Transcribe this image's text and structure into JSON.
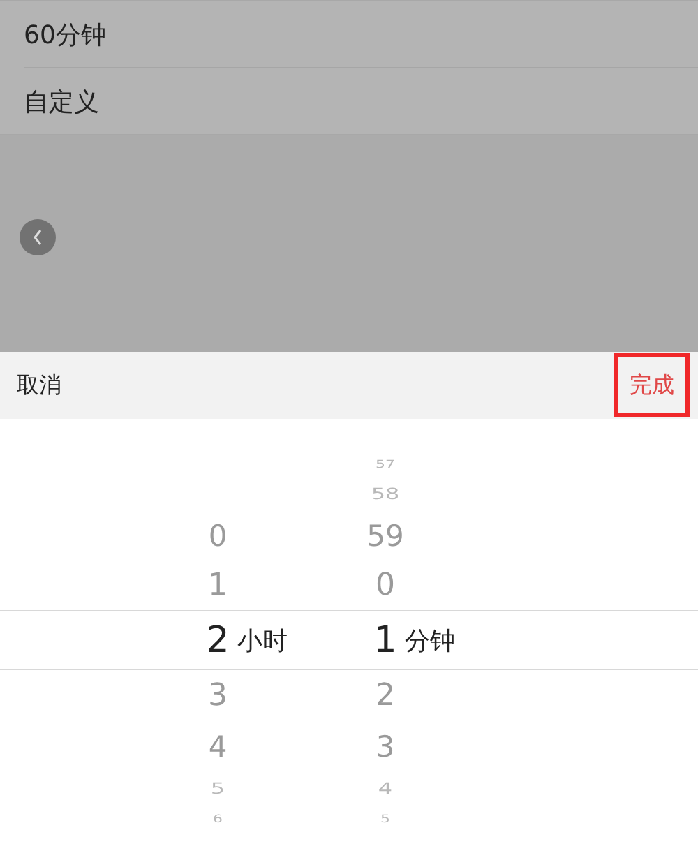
{
  "list": [
    {
      "label": "60分钟"
    },
    {
      "label": "自定义"
    }
  ],
  "toolbar": {
    "cancel": "取消",
    "done": "完成",
    "done_highlighted": true
  },
  "picker": {
    "columns": [
      {
        "unit": "小时",
        "items": [
          {
            "text": "0",
            "selected": false
          },
          {
            "text": "1",
            "selected": false
          },
          {
            "text": "2",
            "selected": true
          },
          {
            "text": "3",
            "selected": false
          },
          {
            "text": "4",
            "selected": false
          },
          {
            "text": "5",
            "selected": false
          },
          {
            "text": "6",
            "selected": false
          }
        ]
      },
      {
        "unit": "分钟",
        "items": [
          {
            "text": "57",
            "selected": false
          },
          {
            "text": "58",
            "selected": false
          },
          {
            "text": "59",
            "selected": false
          },
          {
            "text": "0",
            "selected": false
          },
          {
            "text": "1",
            "selected": true
          },
          {
            "text": "2",
            "selected": false
          },
          {
            "text": "3",
            "selected": false
          },
          {
            "text": "4",
            "selected": false
          },
          {
            "text": "5",
            "selected": false
          }
        ]
      }
    ]
  }
}
